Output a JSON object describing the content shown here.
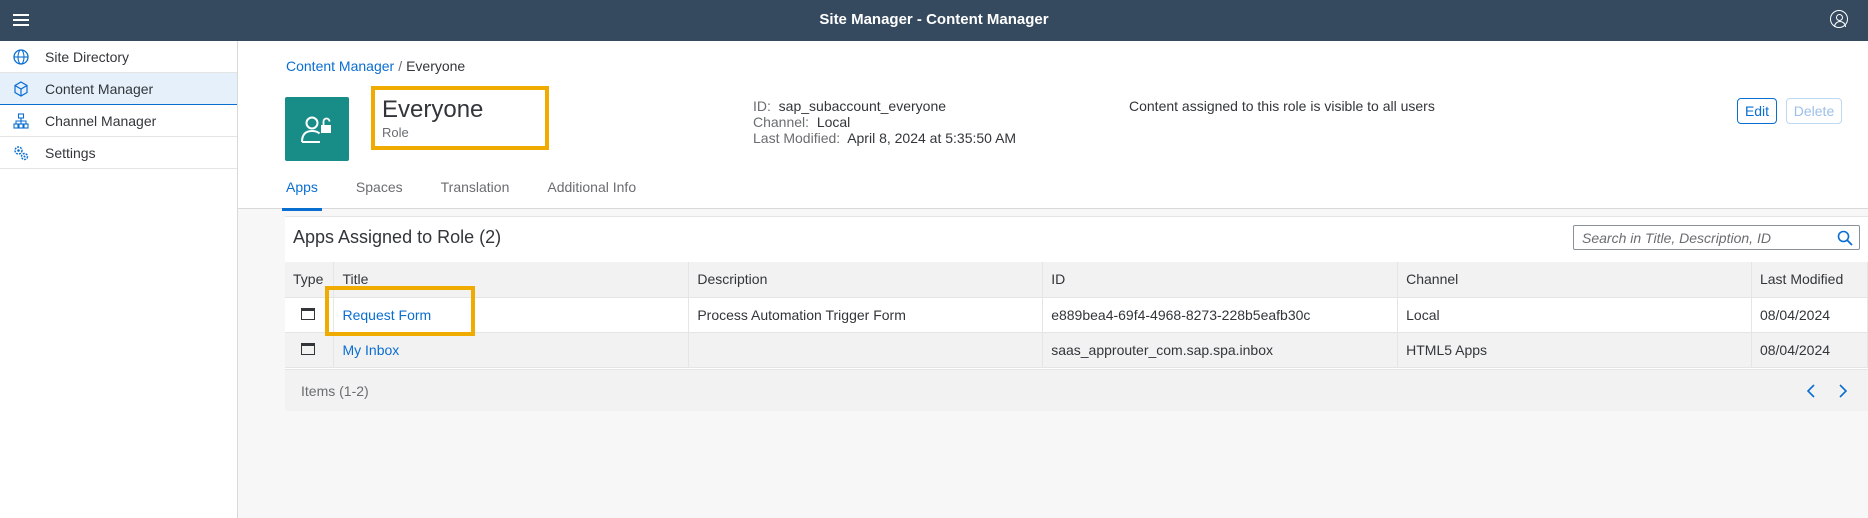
{
  "shell": {
    "title": "Site Manager - Content Manager"
  },
  "sidebar": {
    "items": [
      {
        "label": "Site Directory",
        "icon": "globe-icon"
      },
      {
        "label": "Content Manager",
        "icon": "cube-icon",
        "active": true
      },
      {
        "label": "Channel Manager",
        "icon": "hierarchy-icon"
      },
      {
        "label": "Settings",
        "icon": "gear-icon"
      }
    ]
  },
  "breadcrumb": {
    "parent": "Content Manager",
    "separator": "/",
    "current": "Everyone"
  },
  "role": {
    "title": "Everyone",
    "subtitle": "Role",
    "id_label": "ID:",
    "id_value": "sap_subaccount_everyone",
    "channel_label": "Channel:",
    "channel_value": "Local",
    "modified_label": "Last Modified:",
    "modified_value": "April 8, 2024 at 5:35:50 AM",
    "note": "Content assigned to this role is visible to all users"
  },
  "actions": {
    "edit": "Edit",
    "delete": "Delete"
  },
  "tabs": [
    "Apps",
    "Spaces",
    "Translation",
    "Additional Info"
  ],
  "apps": {
    "title": "Apps Assigned to Role (2)",
    "search_placeholder": "Search in Title, Description, ID",
    "columns": [
      "Type",
      "Title",
      "Description",
      "ID",
      "Channel",
      "Last Modified"
    ],
    "rows": [
      {
        "title": "Request Form",
        "description": "Process Automation Trigger Form",
        "id": "e889bea4-69f4-4968-8273-228b5eafb30c",
        "channel": "Local",
        "modified": "08/04/2024"
      },
      {
        "title": "My Inbox",
        "description": "",
        "id": "saas_approuter_com.sap.spa.inbox",
        "channel": "HTML5 Apps",
        "modified": "08/04/2024"
      }
    ],
    "items_label": "Items (1-2)"
  },
  "colors": {
    "shell": "#354a5f",
    "accent": "#0a6ed1",
    "avatar": "#188c87",
    "highlight": "#f0ab00"
  }
}
